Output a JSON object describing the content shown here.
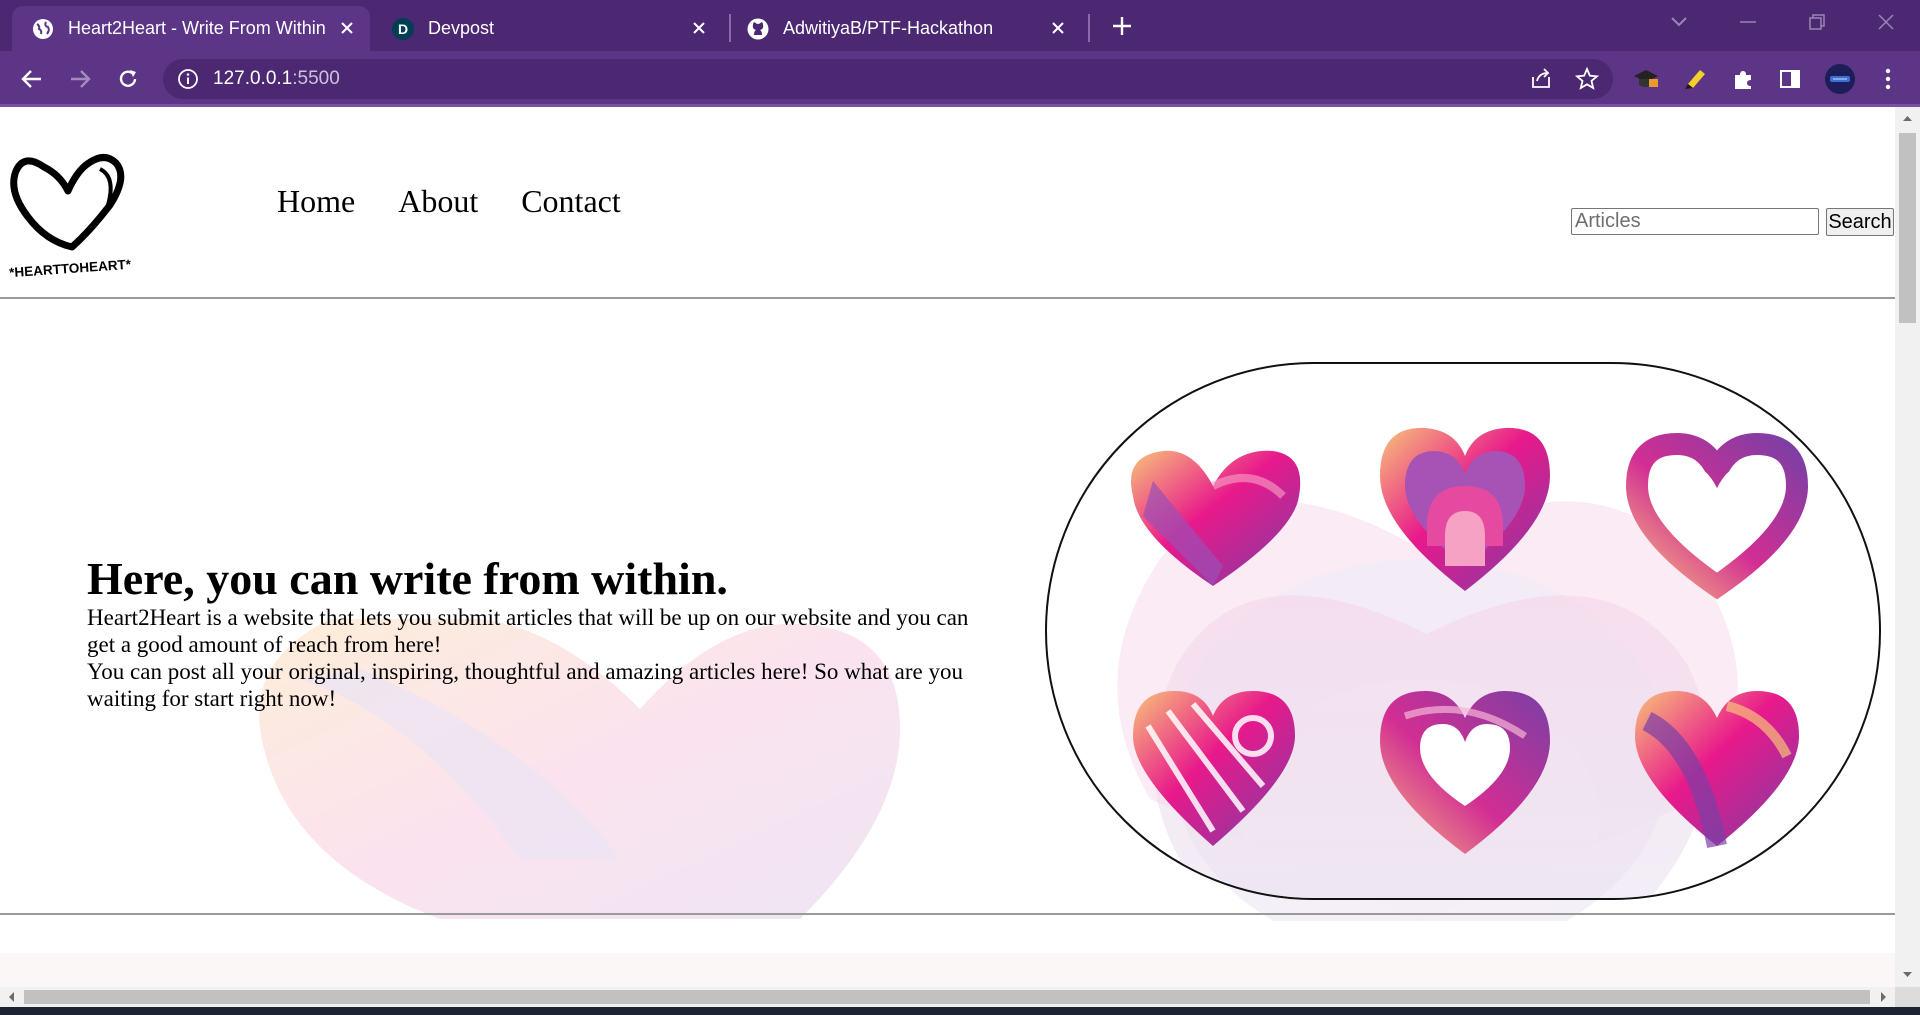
{
  "browser": {
    "tabs": [
      {
        "title": "Heart2Heart - Write From Within",
        "icon": "globe-icon",
        "active": true
      },
      {
        "title": "Devpost",
        "icon": "devpost-icon",
        "icon_letter": "D",
        "active": false
      },
      {
        "title": "AdwitiyaB/PTF-Hackathon",
        "icon": "github-icon",
        "active": false
      }
    ],
    "url_host": "127.0.0.1",
    "url_port": ":5500",
    "colors": {
      "frame": "#4b2871",
      "toolbar": "#5c3587",
      "omnibox": "#4b2871"
    }
  },
  "page": {
    "logo_text": "*HEARTTOHEART*",
    "nav": {
      "home": "Home",
      "about": "About",
      "contact": "Contact"
    },
    "search": {
      "placeholder": "Articles",
      "value": "",
      "button": "Search"
    },
    "hero": {
      "title": "Here, you can write from within.",
      "paragraph_1": "Heart2Heart is a website that lets you submit articles that will be up on our website and you can get a good amount of reach from here!",
      "paragraph_2": "You can post all your original, inspiring, thoughtful and amazing articles here! So what are you waiting for start right now!"
    },
    "colors": {
      "pink": "#e8198b",
      "purple": "#7a3fa5",
      "peach": "#f8c27a"
    }
  }
}
